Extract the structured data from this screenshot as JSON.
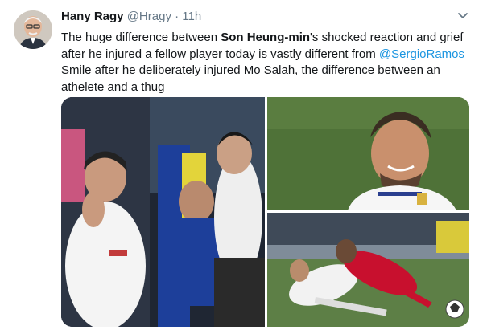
{
  "author": {
    "name": "Hany Ragy",
    "handle": "@Hragy",
    "separator": "·",
    "time": "11h"
  },
  "tweet": {
    "t1": "The huge difference between ",
    "b1": "Son Heung-min",
    "t2": "'s shocked reaction and grief after he injured a fellow player  today is vastly different from  ",
    "mention": "@SergioRamos",
    "t3": " Smile after he deliberately injured Mo Salah, the difference between an athelete and a thug"
  },
  "icons": {
    "avatar": "profile-photo",
    "menu": "chevron-down-icon"
  },
  "colors": {
    "link": "#1b95e0",
    "text": "#14171a",
    "secondary": "#657786"
  }
}
